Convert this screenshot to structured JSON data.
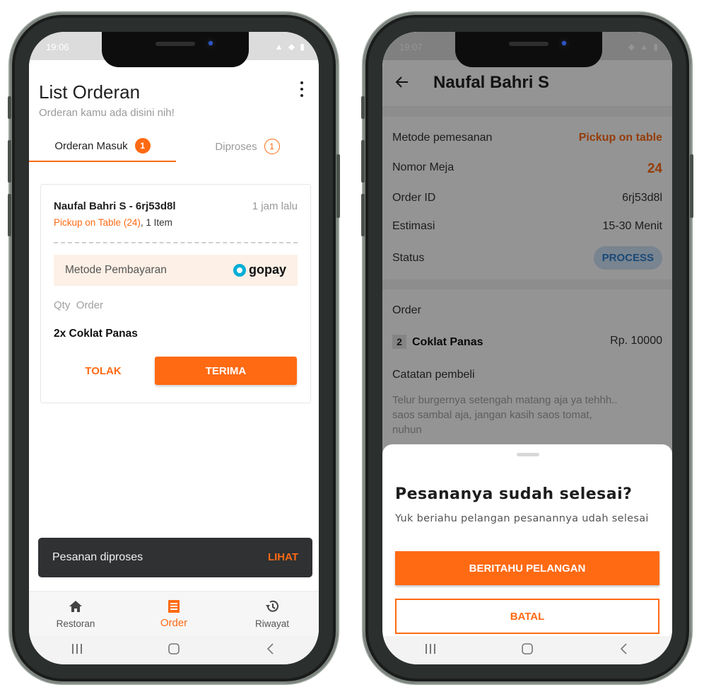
{
  "left": {
    "status_time": "19:06",
    "header": {
      "title": "List Orderan",
      "subtitle": "Orderan kamu ada disini nih!"
    },
    "tabs": [
      {
        "label": "Orderan Masuk",
        "count": "1"
      },
      {
        "label": "Diproses",
        "count": "1"
      }
    ],
    "order": {
      "name": "Naufal Bahri S - 6rj53d8l",
      "time": "1 jam lalu",
      "pickup": "Pickup on Table (24)",
      "items_count": ", 1 Item",
      "payment_label": "Metode Pembayaran",
      "payment_brand": "gopay",
      "qty_label": "Qty",
      "order_label": "Order",
      "item": "2x  Coklat Panas",
      "reject_label": "TOLAK",
      "accept_label": "TERIMA"
    },
    "snackbar": {
      "text": "Pesanan diproses",
      "action": "LIHAT"
    },
    "bottom_nav": [
      {
        "label": "Restoran",
        "icon": "home-icon"
      },
      {
        "label": "Order",
        "icon": "order-list-icon"
      },
      {
        "label": "Riwayat",
        "icon": "history-icon"
      }
    ]
  },
  "right": {
    "status_time": "19:07",
    "header": {
      "title": "Naufal Bahri S"
    },
    "details": {
      "method_label": "Metode pemesanan",
      "method_value": "Pickup on table",
      "table_label": "Nomor Meja",
      "table_value": "24",
      "orderid_label": "Order ID",
      "orderid_value": "6rj53d8l",
      "estimate_label": "Estimasi",
      "estimate_value": "15-30 Menit",
      "status_label": "Status",
      "status_value": "PROCESS"
    },
    "order": {
      "label": "Order",
      "qty": "2",
      "item": "Coklat Panas",
      "price": "Rp. 10000",
      "note_label": "Catatan pembeli",
      "note": "Telur burgernya setengah matang aja ya tehhh.. saos sambal aja, jangan kasih saos tomat, nuhun"
    },
    "sheet": {
      "title": "Pesananya sudah selesai?",
      "subtitle": "Yuk beriahu pelangan pesanannya udah selesai",
      "confirm_label": "BERITAHU PELANGAN",
      "cancel_label": "BATAL"
    }
  },
  "colors": {
    "accent": "#ff6a13",
    "status_pill": "#cfe3f7",
    "dark_snackbar": "#2f3133"
  }
}
